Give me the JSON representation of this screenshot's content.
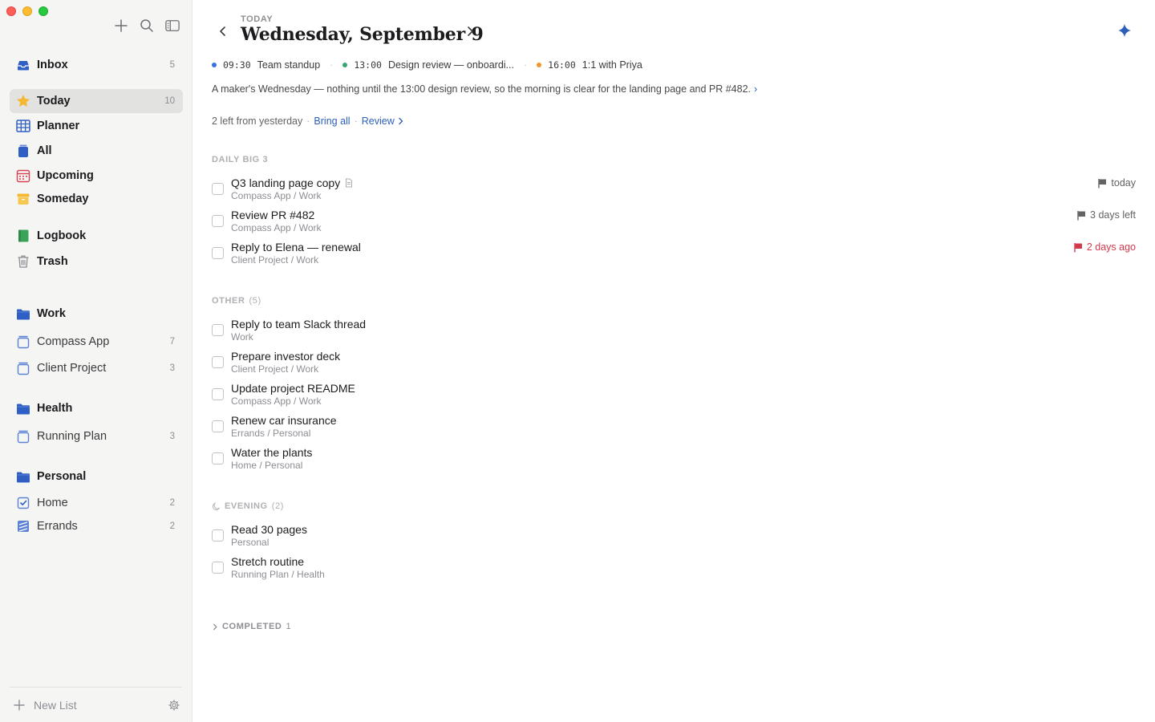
{
  "sidebar": {
    "items": [
      {
        "label": "Inbox",
        "count": "5"
      },
      {
        "label": "Today",
        "count": "10"
      },
      {
        "label": "Planner",
        "count": ""
      },
      {
        "label": "All",
        "count": ""
      },
      {
        "label": "Upcoming",
        "count": ""
      },
      {
        "label": "Someday",
        "count": ""
      },
      {
        "label": "Logbook",
        "count": ""
      },
      {
        "label": "Trash",
        "count": ""
      }
    ],
    "areas": [
      {
        "label": "Work",
        "lists": [
          {
            "label": "Compass App",
            "count": "7"
          },
          {
            "label": "Client Project",
            "count": "3"
          }
        ]
      },
      {
        "label": "Health",
        "lists": [
          {
            "label": "Running Plan",
            "count": "3"
          }
        ]
      },
      {
        "label": "Personal",
        "lists": [
          {
            "label": "Home",
            "count": "2"
          },
          {
            "label": "Errands",
            "count": "2"
          }
        ]
      }
    ],
    "new_list_label": "New List"
  },
  "header": {
    "eyebrow": "TODAY",
    "title": "Wednesday, September 9"
  },
  "events": [
    {
      "time": "09:30",
      "title": "Team standup",
      "color": "#3b6fe0"
    },
    {
      "time": "13:00",
      "title": "Design review — onboardi...",
      "color": "#34a671"
    },
    {
      "time": "16:00",
      "title": "1:1 with Priya",
      "color": "#f0952b"
    }
  ],
  "summary": {
    "text": "A maker's Wednesday — nothing until the 13:00 design review, so the morning is clear for the landing page and PR #482.",
    "more": "›"
  },
  "carryover": {
    "text": "2 left from yesterday",
    "sep": "·",
    "bring_all": "Bring all",
    "review": "Review"
  },
  "sections": {
    "big3": {
      "label": "DAILY BIG 3"
    },
    "other": {
      "label": "OTHER",
      "count": "(5)"
    },
    "evening": {
      "label": "EVENING",
      "count": "(2)"
    },
    "completed": {
      "label": "COMPLETED",
      "count": "1"
    }
  },
  "big3_tasks": [
    {
      "title": "Q3 landing page copy",
      "meta": "Compass App / Work",
      "due": "today",
      "overdue": false
    },
    {
      "title": "Review PR #482",
      "meta": "Compass App / Work",
      "due": "3 days left",
      "overdue": false
    },
    {
      "title": "Reply to Elena — renewal",
      "meta": "Client Project / Work",
      "due": "2 days ago",
      "overdue": true
    }
  ],
  "other_tasks": [
    {
      "title": "Reply to team Slack thread",
      "meta": "Work"
    },
    {
      "title": "Prepare investor deck",
      "meta": "Client Project / Work"
    },
    {
      "title": "Update project README",
      "meta": "Compass App / Work"
    },
    {
      "title": "Renew car insurance",
      "meta": "Errands / Personal"
    },
    {
      "title": "Water the plants",
      "meta": "Home / Personal"
    }
  ],
  "evening_tasks": [
    {
      "title": "Read 30 pages",
      "meta": "Personal"
    },
    {
      "title": "Stretch routine",
      "meta": "Running Plan / Health"
    }
  ],
  "colors": {
    "accent": "#2c5fb7",
    "overdue": "#d03a4c",
    "folder": "#2f5fc4",
    "today_star": "#f5b82e"
  }
}
